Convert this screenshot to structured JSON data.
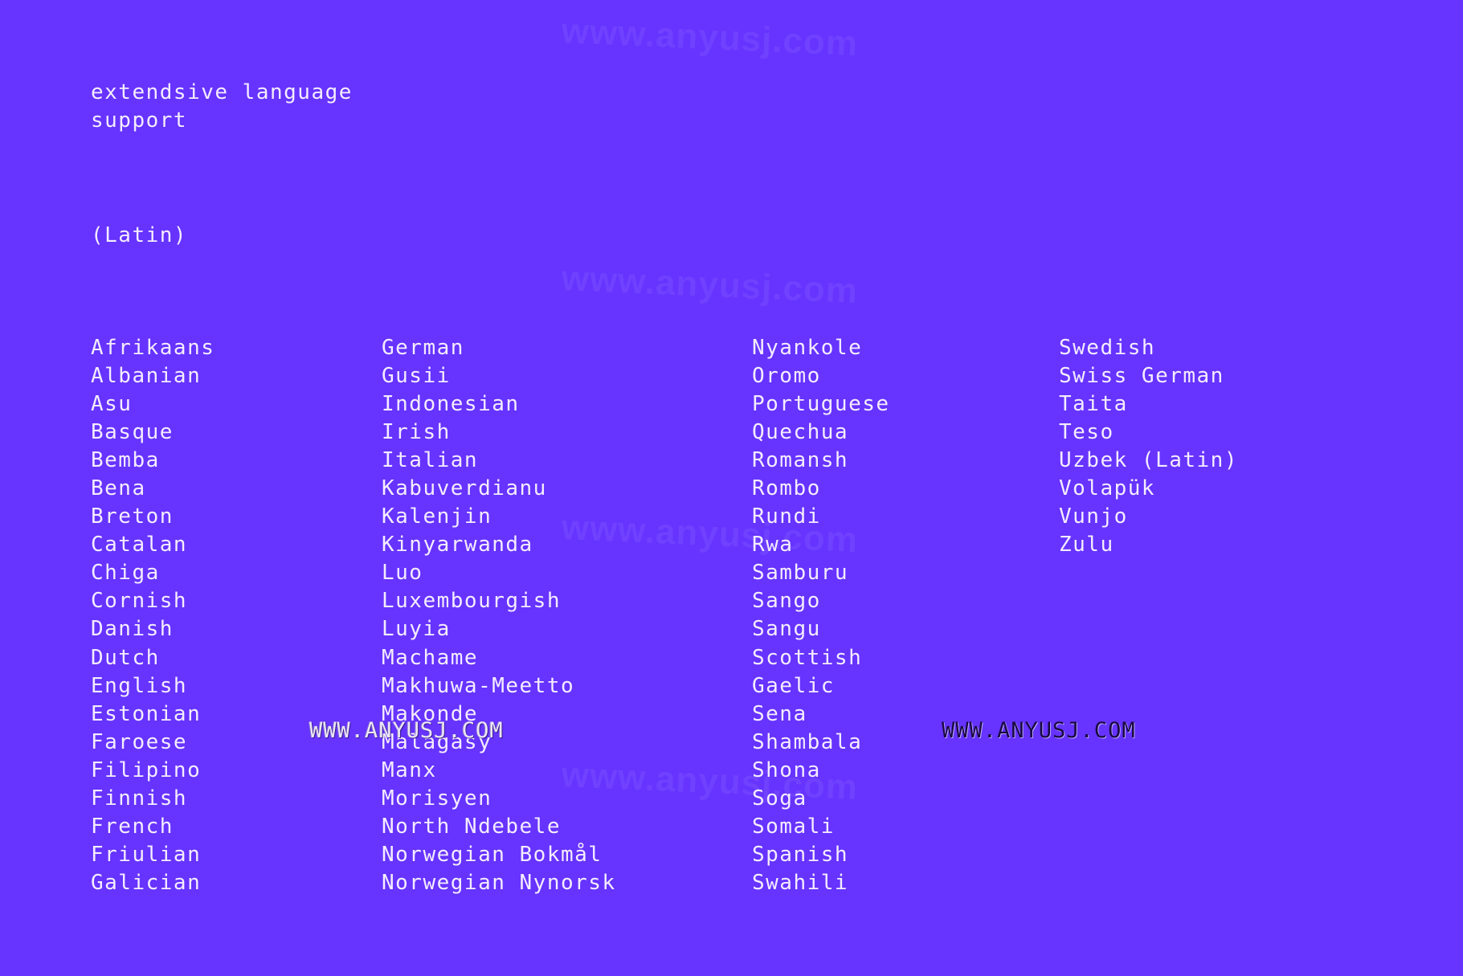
{
  "heading": "extendsive language\nsupport",
  "subheading": "(Latin)",
  "columns": [
    {
      "items": [
        "Afrikaans",
        "Albanian",
        "Asu",
        "Basque",
        "Bemba",
        "Bena",
        "Breton",
        "Catalan",
        "Chiga",
        "Cornish",
        "Danish",
        "Dutch",
        "English",
        "Estonian",
        "Faroese",
        "Filipino",
        "Finnish",
        "French",
        "Friulian",
        "Galician"
      ]
    },
    {
      "items": [
        "German",
        "Gusii",
        "Indonesian",
        "Irish",
        "Italian",
        "Kabuverdianu",
        "Kalenjin",
        "Kinyarwanda",
        "Luo",
        "Luxembourgish",
        "Luyia",
        "Machame",
        "Makhuwa-Meetto",
        "Makonde",
        "Malagasy",
        "Manx",
        "Morisyen",
        "North Ndebele",
        "Norwegian Bokmål",
        "Norwegian Nynorsk"
      ]
    },
    {
      "items": [
        "Nyankole",
        "Oromo",
        "Portuguese",
        "Quechua",
        "Romansh",
        "Rombo",
        "Rundi",
        "Rwa",
        "Samburu",
        "Sango",
        "Sangu",
        "Scottish",
        "Gaelic",
        "Sena",
        "Shambala",
        "Shona",
        "Soga",
        "Somali",
        "Spanish",
        "Swahili"
      ]
    },
    {
      "items": [
        "Swedish",
        "Swiss German",
        "Taita",
        "Teso",
        "Uzbek (Latin)",
        "Volapük",
        "Vunjo",
        "Zulu"
      ]
    }
  ],
  "watermarks": {
    "faint": "www.anyusj.com",
    "pixel": "WWW.ANYUSJ.COM"
  },
  "colors": {
    "background": "#6633ff",
    "text": "#f4ecff"
  }
}
